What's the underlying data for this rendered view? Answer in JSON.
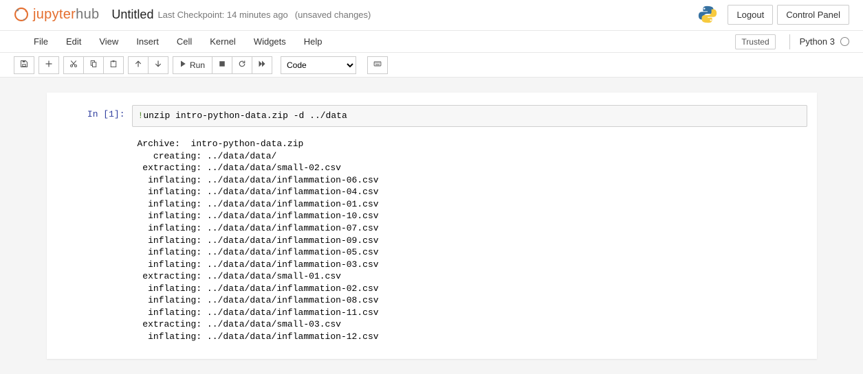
{
  "header": {
    "logo_first": "jupyter",
    "logo_second": "hub",
    "doc_title": "Untitled",
    "checkpoint_text": "Last Checkpoint: 14 minutes ago",
    "unsaved_text": "(unsaved changes)",
    "logout_label": "Logout",
    "control_panel_label": "Control Panel"
  },
  "menubar": {
    "items": [
      "File",
      "Edit",
      "View",
      "Insert",
      "Cell",
      "Kernel",
      "Widgets",
      "Help"
    ],
    "trusted_label": "Trusted",
    "kernel_name": "Python 3"
  },
  "toolbar": {
    "save_title": "Save and Checkpoint",
    "add_title": "Insert cell below",
    "cut_title": "Cut",
    "copy_title": "Copy",
    "paste_title": "Paste",
    "up_title": "Move up",
    "down_title": "Move down",
    "run_title": "Run",
    "run_label": "Run",
    "stop_title": "Interrupt",
    "restart_title": "Restart",
    "ff_title": "Restart and run all",
    "celltype_selected": "Code",
    "cmd_title": "Command palette"
  },
  "cell": {
    "prompt": "In [1]:",
    "bang": "!",
    "code": "unzip intro-python-data.zip -d ../data",
    "output": "Archive:  intro-python-data.zip\n   creating: ../data/data/\n extracting: ../data/data/small-02.csv  \n  inflating: ../data/data/inflammation-06.csv  \n  inflating: ../data/data/inflammation-04.csv  \n  inflating: ../data/data/inflammation-01.csv  \n  inflating: ../data/data/inflammation-10.csv  \n  inflating: ../data/data/inflammation-07.csv  \n  inflating: ../data/data/inflammation-09.csv  \n  inflating: ../data/data/inflammation-05.csv  \n  inflating: ../data/data/inflammation-03.csv  \n extracting: ../data/data/small-01.csv  \n  inflating: ../data/data/inflammation-02.csv  \n  inflating: ../data/data/inflammation-08.csv  \n  inflating: ../data/data/inflammation-11.csv  \n extracting: ../data/data/small-03.csv  \n  inflating: ../data/data/inflammation-12.csv  "
  }
}
